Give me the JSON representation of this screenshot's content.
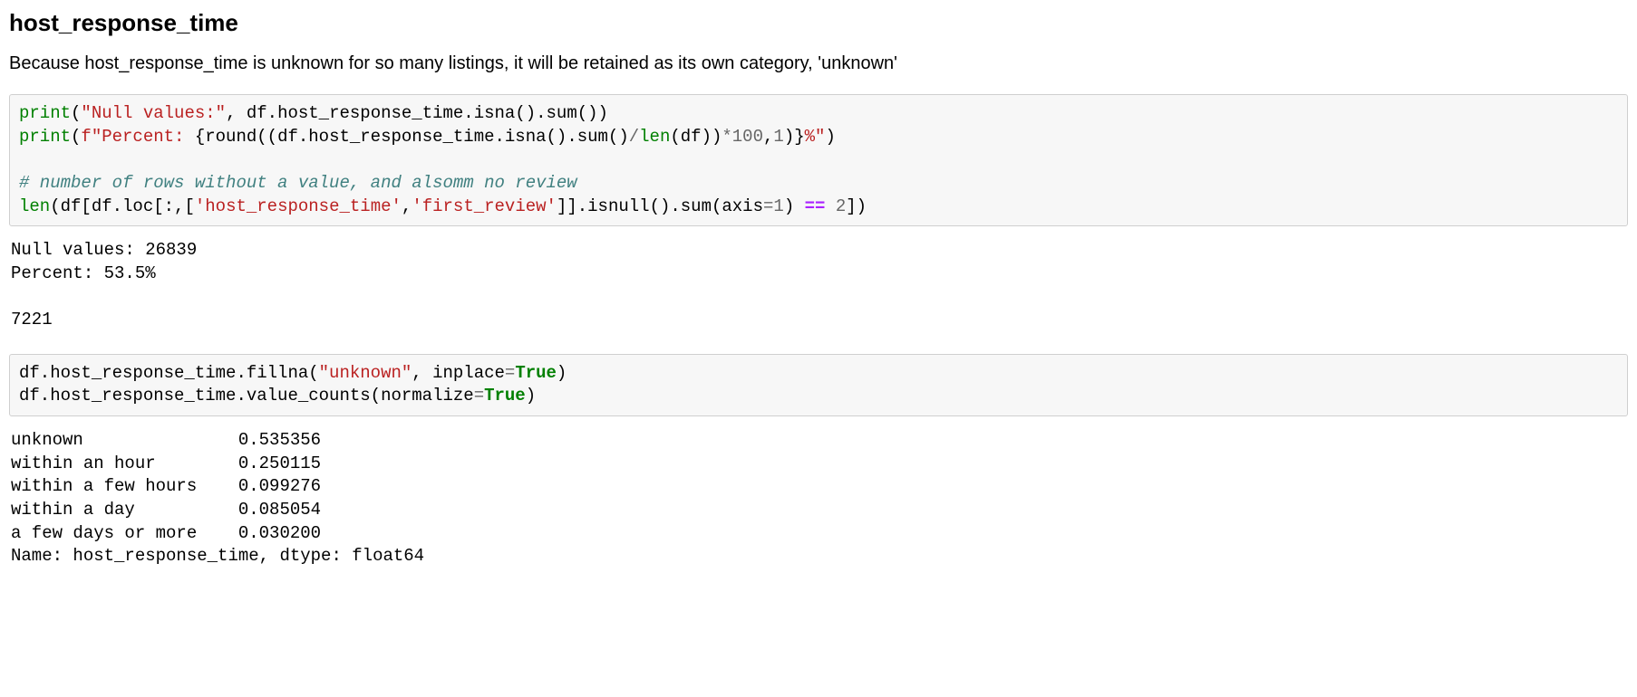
{
  "heading": "host_response_time",
  "description": "Because host_response_time is unknown for so many listings, it will be retained as its own category, 'unknown'",
  "code1": {
    "t_print1": "print",
    "t_lp1": "(",
    "t_str_null": "\"Null values:\"",
    "t_comma1": ", df.host_response_time.isna().sum())",
    "t_print2": "print",
    "t_lp2": "(",
    "t_fstr_open": "f\"Percent: ",
    "t_fexpr1": "{",
    "t_round": "round",
    "t_fexpr2": "((df.host_response_time.isna().sum()",
    "t_div": "/",
    "t_len": "len",
    "t_fexpr3": "(df))",
    "t_mul": "*",
    "t_num100": "100",
    "t_comma2": ",",
    "t_num1": "1",
    "t_fexpr4": ")}",
    "t_fstr_close": "%\"",
    "t_rp2": ")",
    "t_comment": "# number of rows without a value, and alsomm no review",
    "t_len2": "len",
    "t_line4a": "(df[df.loc[:,[",
    "t_strhrt": "'host_response_time'",
    "t_comma3": ",",
    "t_strfr": "'first_review'",
    "t_line4b": "]].isnull().sum(axis",
    "t_eq1": "=",
    "t_num1b": "1",
    "t_line4c": ") ",
    "t_eqeq": "==",
    "t_space": " ",
    "t_num2": "2",
    "t_line4d": "])"
  },
  "output1": {
    "line1": "Null values: 26839",
    "line2": "Percent: 53.5%",
    "line3": "7221"
  },
  "code2": {
    "t_l1a": "df.host_response_time.fillna(",
    "t_str_unk": "\"unknown\"",
    "t_l1b": ", inplace",
    "t_eq2": "=",
    "t_true1": "True",
    "t_l1c": ")",
    "t_l2a": "df.host_response_time.value_counts(normalize",
    "t_eq3": "=",
    "t_true2": "True",
    "t_l2b": ")"
  },
  "output2": {
    "row1_label": "unknown             ",
    "row1_val": "  0.535356",
    "row2_label": "within an hour      ",
    "row2_val": "  0.250115",
    "row3_label": "within a few hours  ",
    "row3_val": "  0.099276",
    "row4_label": "within a day        ",
    "row4_val": "  0.085054",
    "row5_label": "a few days or more  ",
    "row5_val": "  0.030200",
    "footer": "Name: host_response_time, dtype: float64"
  }
}
